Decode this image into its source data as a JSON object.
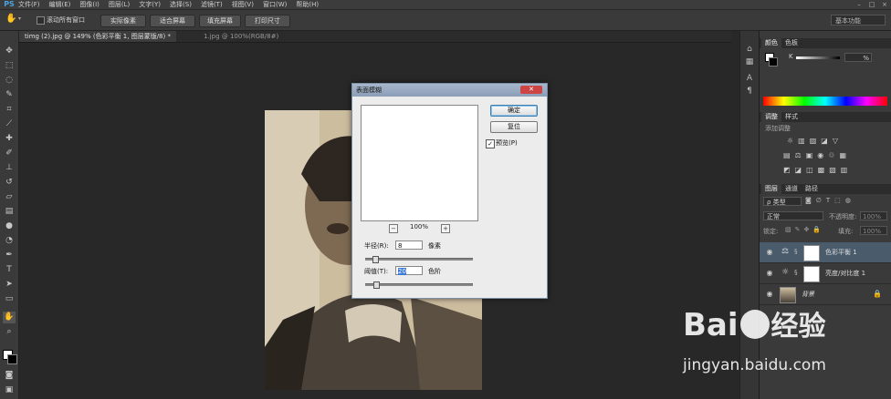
{
  "menubar": {
    "logo": "PS",
    "items": [
      "文件(F)",
      "编辑(E)",
      "图像(I)",
      "图层(L)",
      "文字(Y)",
      "选择(S)",
      "滤镜(T)",
      "视图(V)",
      "窗口(W)",
      "帮助(H)"
    ]
  },
  "options": {
    "scroll_all_windows": "滚动所有窗口",
    "actual_pixels": "实际像素",
    "fit_screen": "适合屏幕",
    "fill_screen": "填充屏幕",
    "print_size": "打印尺寸",
    "workspace": "基本功能"
  },
  "doc_tabs": [
    {
      "label": "timg (2).jpg @ 149% (色彩平衡 1, 图层蒙版/8) *"
    },
    {
      "label": "1.jpg @ 100%(RGB/8#)"
    }
  ],
  "panels": {
    "color_tabs": [
      "颜色",
      "色板"
    ],
    "color_value": "%",
    "adjust_tabs": [
      "调整",
      "样式"
    ],
    "add_adjustment": "添加调整",
    "layers_tabs": [
      "图层",
      "通道",
      "路径"
    ],
    "kind_filter": "类型",
    "blend_mode": "正常",
    "opacity_label": "不透明度:",
    "opacity_value": "100%",
    "lock_label": "锁定:",
    "fill_label": "填充:",
    "fill_value": "100%",
    "layers": [
      {
        "name": "色彩平衡 1",
        "selected": true
      },
      {
        "name": "亮度/对比度 1",
        "selected": false
      },
      {
        "name": "背景",
        "selected": false
      }
    ]
  },
  "dialog": {
    "title": "表面模糊",
    "ok": "确定",
    "reset": "复位",
    "preview_label": "预览(P)",
    "preview_checked": true,
    "zoom": "100%",
    "radius_label": "半径(R):",
    "radius_value": "8",
    "radius_unit": "像素",
    "threshold_label": "阈值(T):",
    "threshold_value": "20",
    "threshold_unit": "色阶",
    "radius_slider": 0.07,
    "threshold_slider": 0.08
  },
  "watermark": {
    "brand": "Bai",
    "brand2": "经验",
    "url": "jingyan.baidu.com"
  },
  "colors": {
    "app_bg": "#282828",
    "panel_bg": "#3a3a3a",
    "selected_layer": "#4a5b6b",
    "dialog_titlebar": "#8b9eb7"
  }
}
